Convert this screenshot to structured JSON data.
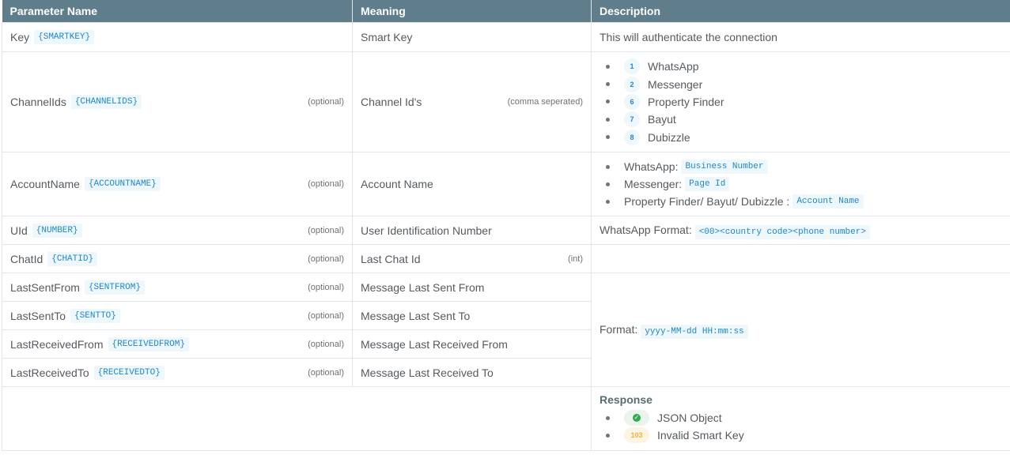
{
  "headers": {
    "param": "Parameter Name",
    "meaning": "Meaning",
    "description": "Description"
  },
  "rows": {
    "key": {
      "name": "Key",
      "code": "{SMARTKEY}",
      "meaning": "Smart Key",
      "desc": "This will authenticate the connection"
    },
    "channelids": {
      "name": "ChannelIds",
      "code": "{CHANNELIDS}",
      "opt": "(optional)",
      "meaning": "Channel Id's",
      "meaning_note": "(comma seperated)",
      "channels": [
        {
          "num": "1",
          "label": "WhatsApp"
        },
        {
          "num": "2",
          "label": "Messenger"
        },
        {
          "num": "6",
          "label": "Property Finder"
        },
        {
          "num": "7",
          "label": "Bayut"
        },
        {
          "num": "8",
          "label": "Dubizzle"
        }
      ]
    },
    "accountname": {
      "name": "AccountName",
      "code": "{ACCOUNTNAME}",
      "opt": "(optional)",
      "meaning": "Account Name",
      "items": [
        {
          "label": "WhatsApp:",
          "code": "Business Number"
        },
        {
          "label": "Messenger:",
          "code": "Page Id"
        },
        {
          "label": "Property Finder/ Bayut/ Dubizzle :",
          "code": "Account Name"
        }
      ]
    },
    "uid": {
      "name": "UId",
      "code": "{NUMBER}",
      "opt": "(optional)",
      "meaning": "User Identification Number",
      "desc_label": "WhatsApp Format:",
      "desc_code": "<00><country code><phone number>"
    },
    "chatid": {
      "name": "ChatId",
      "code": "{CHATID}",
      "opt": "(optional)",
      "meaning": "Last Chat Id",
      "meaning_note": "(int)"
    },
    "lastsentfrom": {
      "name": "LastSentFrom",
      "code": "{SENTFROM}",
      "opt": "(optional)",
      "meaning": "Message Last Sent From"
    },
    "lastsentto": {
      "name": "LastSentTo",
      "code": "{SENTTO}",
      "opt": "(optional)",
      "meaning": "Message Last Sent To"
    },
    "lastreceivedfrom": {
      "name": "LastReceivedFrom",
      "code": "{RECEIVEDFROM}",
      "opt": "(optional)",
      "meaning": "Message Last Received From"
    },
    "lastreceivedto": {
      "name": "LastReceivedTo",
      "code": "{RECEIVEDTO}",
      "opt": "(optional)",
      "meaning": "Message Last Received To"
    }
  },
  "format": {
    "label": "Format:",
    "code": "yyyy-MM-dd HH:mm:ss"
  },
  "response": {
    "title": "Response",
    "ok_label": "JSON Object",
    "error_code": "103",
    "error_label": "Invalid Smart Key"
  },
  "colors": {
    "header_bg": "#607d8b",
    "code_text": "#1e88c7",
    "code_bg": "#eef7fb",
    "ok": "#34a853",
    "warn": "#e9b53b"
  }
}
